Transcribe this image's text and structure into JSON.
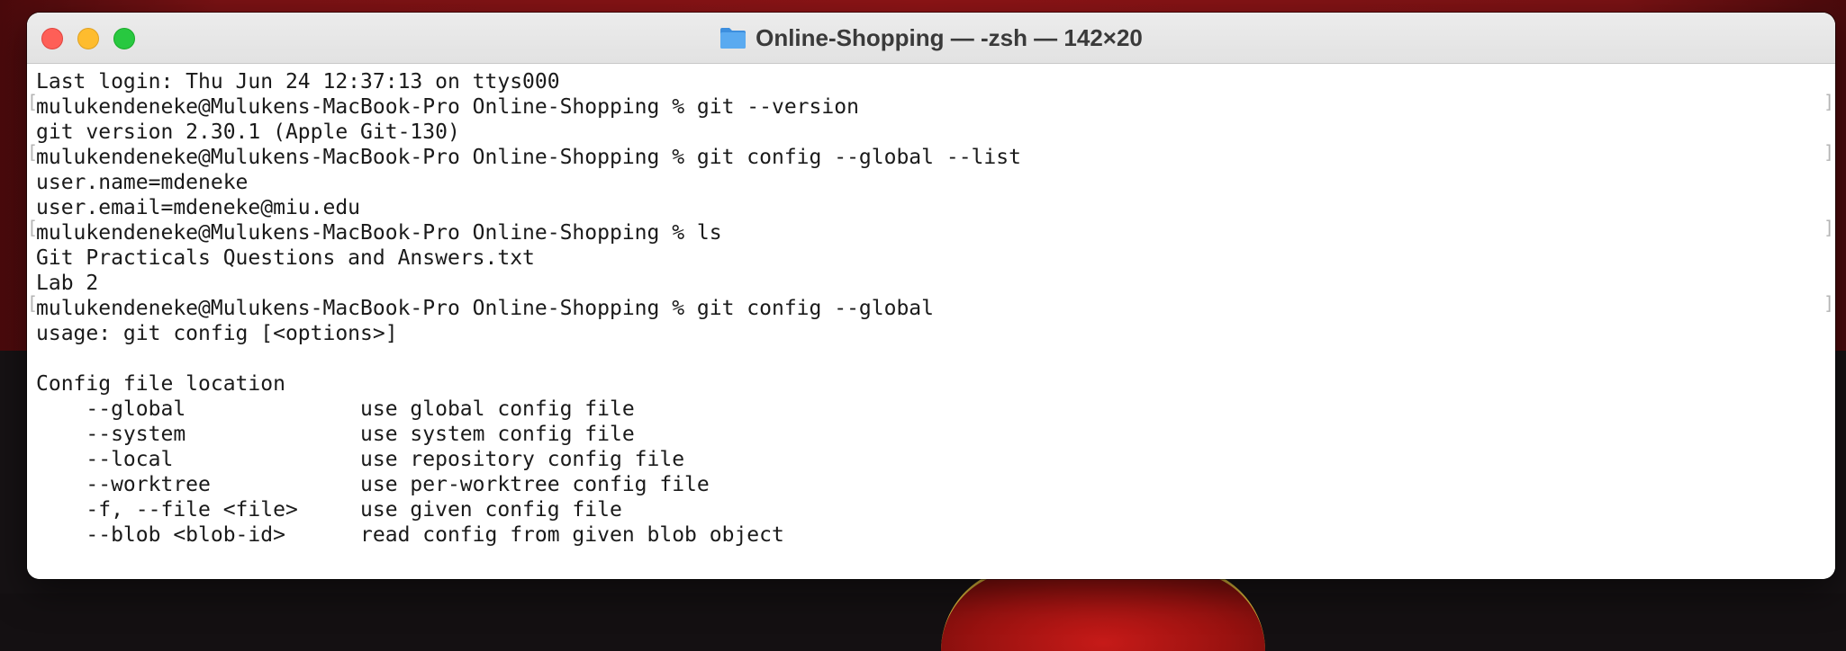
{
  "window": {
    "title": "Online-Shopping — -zsh — 142×20",
    "folder_icon": "folder-icon",
    "buttons": {
      "close": "close-button",
      "minimize": "minimize-button",
      "zoom": "zoom-button"
    },
    "colors": {
      "close": "#fe5f57",
      "minimize": "#febc2e",
      "zoom": "#28c840",
      "folder": "#5aaaf0"
    }
  },
  "terminal": {
    "lines": [
      "Last login: Thu Jun 24 12:37:13 on ttys000",
      "mulukendeneke@Mulukens-MacBook-Pro Online-Shopping % git --version",
      "git version 2.30.1 (Apple Git-130)",
      "mulukendeneke@Mulukens-MacBook-Pro Online-Shopping % git config --global --list",
      "user.name=mdeneke",
      "user.email=mdeneke@miu.edu",
      "mulukendeneke@Mulukens-MacBook-Pro Online-Shopping % ls",
      "Git Practicals Questions and Answers.txt",
      "Lab 2",
      "mulukendeneke@Mulukens-MacBook-Pro Online-Shopping % git config --global",
      "usage: git config [<options>]",
      "",
      "Config file location",
      "    --global              use global config file",
      "    --system              use system config file",
      "    --local               use repository config file",
      "    --worktree            use per-worktree config file",
      "    -f, --file <file>     use given config file",
      "    --blob <blob-id>      read config from given blob object"
    ],
    "mark_open": "[",
    "mark_close": "]"
  }
}
